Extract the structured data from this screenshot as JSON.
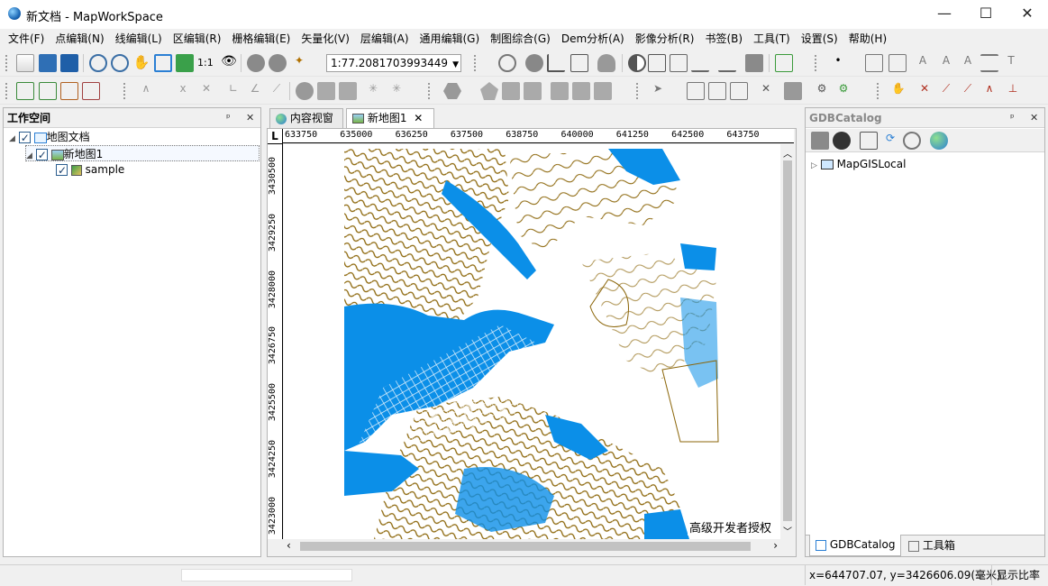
{
  "window": {
    "title": "新文档 - MapWorkSpace",
    "minimize": "—",
    "maximize": "☐",
    "close": "✕"
  },
  "menu": [
    "文件(F)",
    "点编辑(N)",
    "线编辑(L)",
    "区编辑(R)",
    "栅格编辑(E)",
    "矢量化(V)",
    "层编辑(A)",
    "通用编辑(G)",
    "制图综合(G)",
    "Dem分析(A)",
    "影像分析(R)",
    "书签(B)",
    "工具(T)",
    "设置(S)",
    "帮助(H)"
  ],
  "toolbar": {
    "scale_value": "1:77.2081703993449",
    "one_to_one": "1:1"
  },
  "workspace": {
    "title": "工作空间",
    "pin": "ᵖ",
    "close": "✕",
    "tree": {
      "doc": "地图文档",
      "map": "新地图1",
      "layer": "sample"
    }
  },
  "tabs": {
    "content_view": "内容视窗",
    "new_map": "新地图1",
    "close": "✕",
    "ruler_corner": "L"
  },
  "ruler": {
    "x_labels": [
      "633750",
      "635000",
      "636250",
      "637500",
      "638750",
      "640000",
      "641250",
      "642500",
      "643750"
    ],
    "y_labels": [
      "3430500",
      "3429250",
      "3428000",
      "3426750",
      "3425500",
      "3424250",
      "3423000"
    ]
  },
  "map": {
    "watermark": "高级开发者授权",
    "land_color": "#8b6508",
    "water_color": "#0b8fe8"
  },
  "catalog": {
    "title": "GDBCatalog",
    "tree_item": "MapGISLocal",
    "tab_catalog": "GDBCatalog",
    "tab_toolbox": "工具箱"
  },
  "status": {
    "coords": "x=644707.07, y=3426606.09(毫米)",
    "ratio_label": "显示比率"
  }
}
